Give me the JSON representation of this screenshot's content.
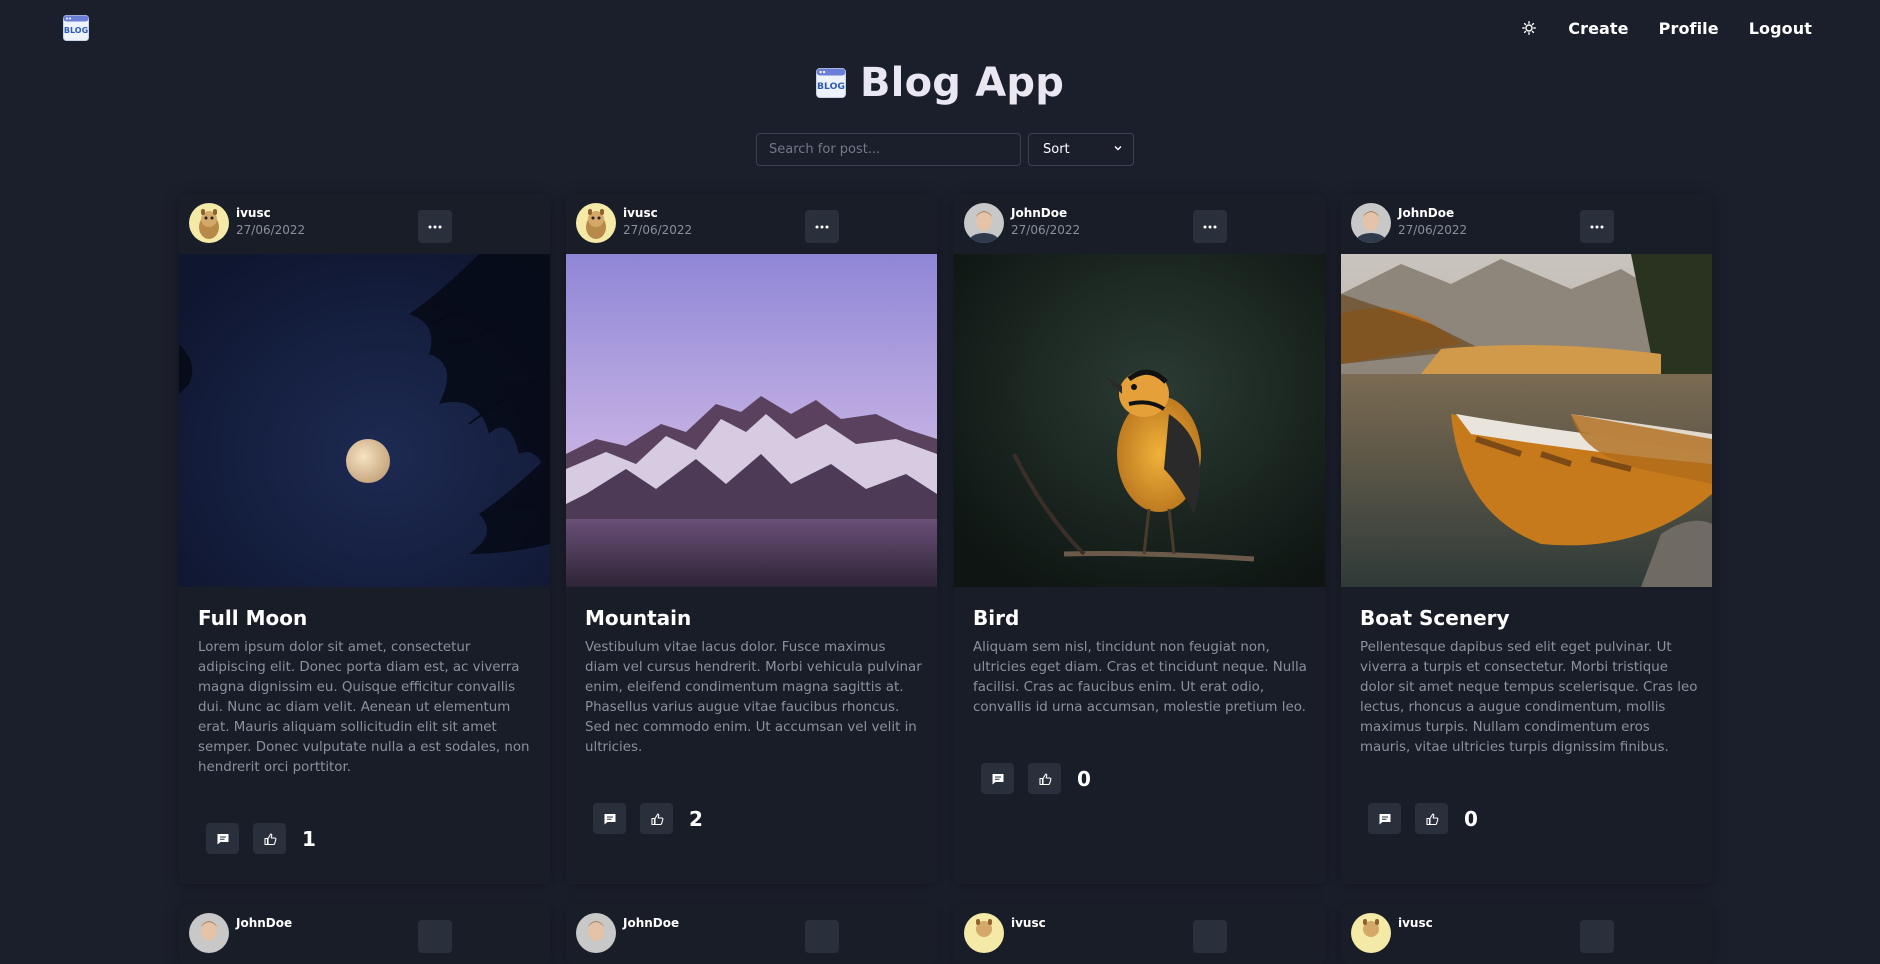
{
  "nav": {
    "logo_text": "BLOG",
    "links": [
      "Create",
      "Profile",
      "Logout"
    ]
  },
  "header": {
    "title": "Blog App",
    "logo_text": "BLOG"
  },
  "search": {
    "placeholder": "Search for post..."
  },
  "sort": {
    "label": "Sort"
  },
  "posts": [
    {
      "author": "ivusc",
      "date": "27/06/2022",
      "title": "Full Moon",
      "body": "Lorem ipsum dolor sit amet, consectetur adipiscing elit. Donec porta diam est, ac viverra magna dignissim eu. Quisque efficitur convallis dui. Nunc ac diam velit. Aenean ut elementum erat. Mauris aliquam sollicitudin elit sit amet semper. Donec vulputate nulla a est sodales, non hendrerit orci porttitor.",
      "likes": "1"
    },
    {
      "author": "ivusc",
      "date": "27/06/2022",
      "title": "Mountain",
      "body": "Vestibulum vitae lacus dolor. Fusce maximus diam vel cursus hendrerit. Morbi vehicula pulvinar enim, eleifend condimentum magna sagittis at. Phasellus varius augue vitae faucibus rhoncus. Sed nec commodo enim. Ut accumsan vel velit in ultricies.",
      "likes": "2"
    },
    {
      "author": "JohnDoe",
      "date": "27/06/2022",
      "title": "Bird",
      "body": "Aliquam sem nisl, tincidunt non feugiat non, ultricies eget diam. Cras et tincidunt neque. Nulla facilisi. Cras ac faucibus enim. Ut erat odio, convallis id urna accumsan, molestie pretium leo.",
      "likes": "0"
    },
    {
      "author": "JohnDoe",
      "date": "27/06/2022",
      "title": "Boat Scenery",
      "body": "Pellentesque dapibus sed elit eget pulvinar. Ut viverra a turpis et consectetur. Morbi tristique dolor sit amet neque tempus scelerisque. Cras leo lectus, rhoncus a augue condimentum, mollis maximus turpis. Nullam condimentum eros mauris, vitae ultricies turpis dignissim finibus.",
      "likes": "0"
    }
  ],
  "next_row": [
    {
      "author": "JohnDoe"
    },
    {
      "author": "JohnDoe"
    },
    {
      "author": "ivusc"
    },
    {
      "author": "ivusc"
    }
  ],
  "colors": {
    "background": "#1b1f2c",
    "card": "#191d28",
    "button": "#2a2f3c",
    "muted_text": "#8b909c"
  }
}
